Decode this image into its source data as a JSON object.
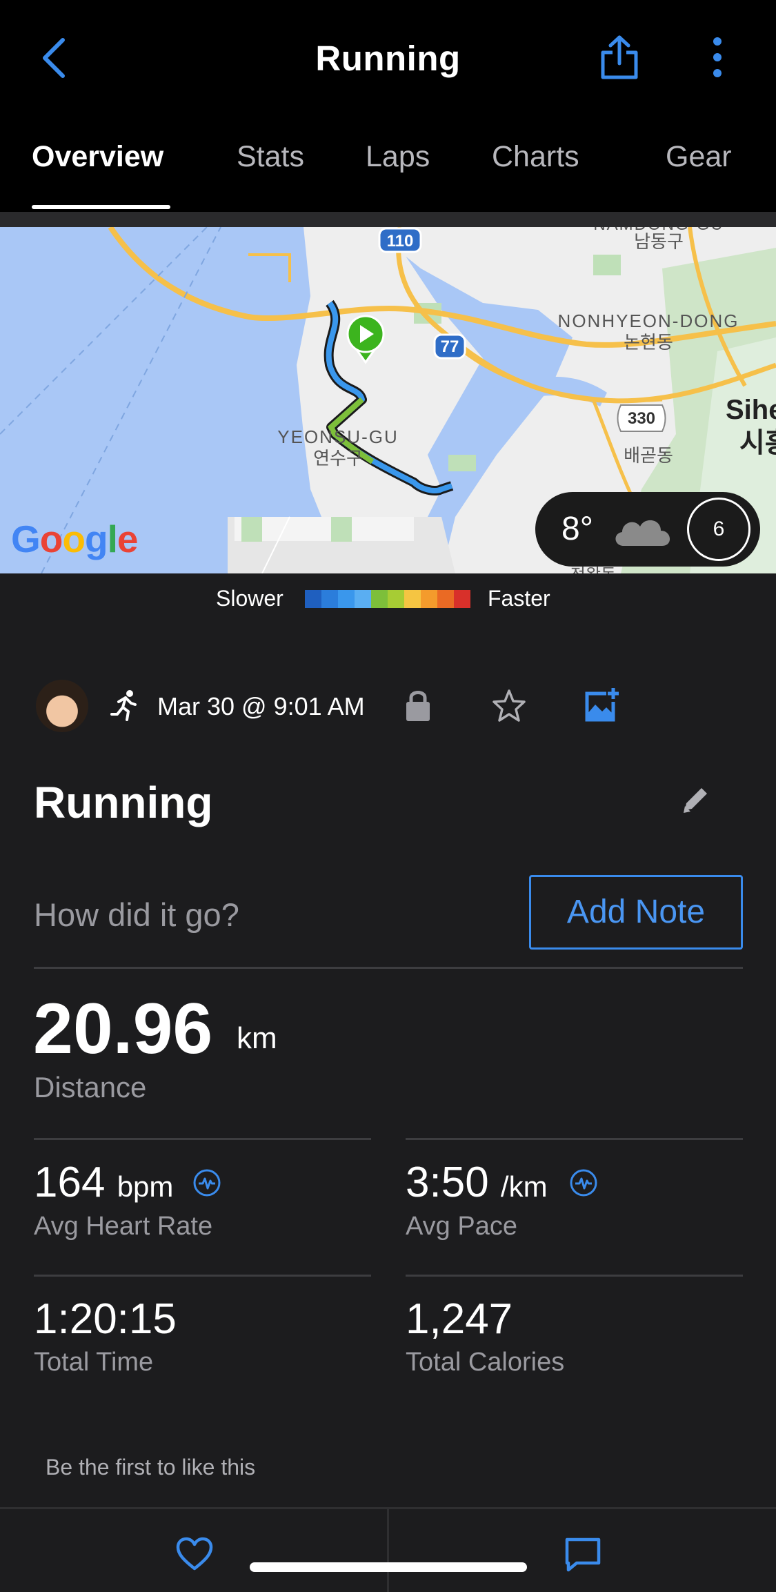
{
  "header": {
    "title": "Running"
  },
  "tabs": [
    {
      "label": "Overview",
      "active": true
    },
    {
      "label": "Stats",
      "active": false
    },
    {
      "label": "Laps",
      "active": false
    },
    {
      "label": "Charts",
      "active": false
    },
    {
      "label": "Gear",
      "active": false
    }
  ],
  "map": {
    "labels": {
      "district1": "YEONSU-GU",
      "district1_kr": "연수구",
      "district2": "NONHYEON-DONG",
      "district2_kr": "논현동",
      "district3_kr": "남동구",
      "district4_kr": "배곧동",
      "district5": "Sihe",
      "district5_kr": "시흥",
      "top_cut": "NAMDONG-GU",
      "bottom_cut": "정왕동",
      "road1": "110",
      "road2": "77",
      "road3": "330"
    },
    "google_logo": "Google",
    "weather": {
      "temp": "8°",
      "wind": "6"
    }
  },
  "legend": {
    "slower": "Slower",
    "faster": "Faster",
    "colors": [
      "#1f5fbf",
      "#2b7ddb",
      "#3a97ec",
      "#5aaef2",
      "#7dbf3a",
      "#a7cc34",
      "#f5c542",
      "#f49b2c",
      "#ea6a24",
      "#d8302a"
    ]
  },
  "activity": {
    "datetime": "Mar 30 @ 9:01 AM",
    "title": "Running",
    "note_prompt": "How did it go?",
    "add_note": "Add Note"
  },
  "stats": {
    "distance": {
      "value": "20.96",
      "unit": "km",
      "label": "Distance"
    },
    "heart_rate": {
      "value": "164",
      "unit": "bpm",
      "label": "Avg Heart Rate"
    },
    "pace": {
      "value": "3:50",
      "unit": "/km",
      "label": "Avg Pace"
    },
    "time": {
      "value": "1:20:15",
      "label": "Total Time"
    },
    "calories": {
      "value": "1,247",
      "label": "Total Calories"
    }
  },
  "social": {
    "likes_text": "Be the first to like this"
  },
  "colors": {
    "accent": "#3a8bec",
    "background": "#1c1c1e",
    "start_pin": "#3cb41e"
  }
}
